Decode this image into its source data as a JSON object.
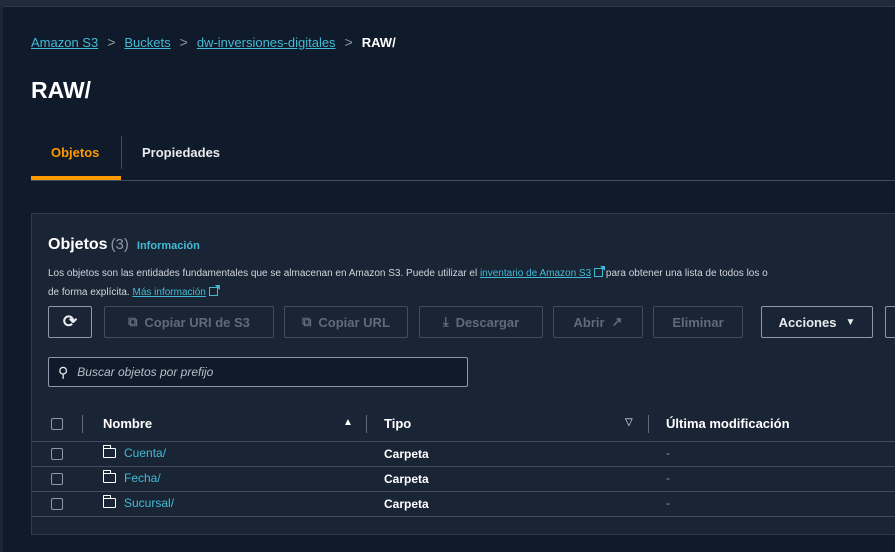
{
  "breadcrumb": {
    "items": [
      "Amazon S3",
      "Buckets",
      "dw-inversiones-digitales"
    ],
    "current": "RAW/"
  },
  "page": {
    "title": "RAW/"
  },
  "tabs": [
    {
      "label": "Objetos",
      "active": true
    },
    {
      "label": "Propiedades",
      "active": false
    }
  ],
  "objects": {
    "title": "Objetos",
    "count": "(3)",
    "info": "Información",
    "description_pre": "Los objetos son las entidades fundamentales que se almacenan en Amazon S3. Puede utilizar el ",
    "inventory_link": "inventario de Amazon S3",
    "description_post": " para obtener una lista de todos los o",
    "description_line2": "de forma explícita. ",
    "more_info": "Más información"
  },
  "toolbar": {
    "copy_uri": "Copiar URI de S3",
    "copy_url": "Copiar URL",
    "download": "Descargar",
    "open": "Abrir",
    "delete": "Eliminar",
    "actions": "Acciones"
  },
  "search": {
    "placeholder": "Buscar objetos por prefijo"
  },
  "table": {
    "columns": [
      "Nombre",
      "Tipo",
      "Última modificación"
    ],
    "rows": [
      {
        "name": "Cuenta/",
        "type": "Carpeta",
        "modified": "-"
      },
      {
        "name": "Fecha/",
        "type": "Carpeta",
        "modified": "-"
      },
      {
        "name": "Sucursal/",
        "type": "Carpeta",
        "modified": "-"
      }
    ]
  },
  "colors": {
    "accent": "#ff9900",
    "link": "#44b9d6",
    "background": "#0f1b2a",
    "panel": "#192534"
  }
}
